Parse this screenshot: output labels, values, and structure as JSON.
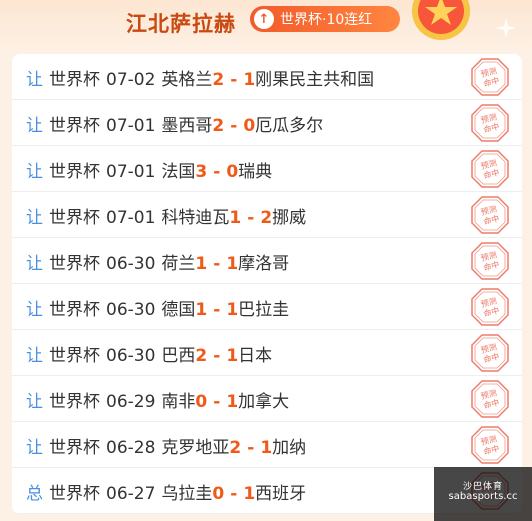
{
  "header": {
    "expert_name": "江北萨拉赫",
    "streak_label": "世界杯·10连红"
  },
  "matches": [
    {
      "kind": "让",
      "league": "世界杯",
      "date": "07-02",
      "home": "英格兰",
      "home_score": "2",
      "away_score": "1",
      "away": "刚果民主共和国",
      "stamp": "预测命中"
    },
    {
      "kind": "让",
      "league": "世界杯",
      "date": "07-01",
      "home": "墨西哥",
      "home_score": "2",
      "away_score": "0",
      "away": "厄瓜多尔",
      "stamp": "预测命中"
    },
    {
      "kind": "让",
      "league": "世界杯",
      "date": "07-01",
      "home": "法国",
      "home_score": "3",
      "away_score": "0",
      "away": "瑞典",
      "stamp": "预测命中"
    },
    {
      "kind": "让",
      "league": "世界杯",
      "date": "07-01",
      "home": "科特迪瓦",
      "home_score": "1",
      "away_score": "2",
      "away": "挪威",
      "stamp": "预测命中"
    },
    {
      "kind": "让",
      "league": "世界杯",
      "date": "06-30",
      "home": "荷兰",
      "home_score": "1",
      "away_score": "1",
      "away": "摩洛哥",
      "stamp": "预测命中"
    },
    {
      "kind": "让",
      "league": "世界杯",
      "date": "06-30",
      "home": "德国",
      "home_score": "1",
      "away_score": "1",
      "away": "巴拉圭",
      "stamp": "预测命中"
    },
    {
      "kind": "让",
      "league": "世界杯",
      "date": "06-30",
      "home": "巴西",
      "home_score": "2",
      "away_score": "1",
      "away": "日本",
      "stamp": "预测命中"
    },
    {
      "kind": "让",
      "league": "世界杯",
      "date": "06-29",
      "home": "南非",
      "home_score": "0",
      "away_score": "1",
      "away": "加拿大",
      "stamp": "预测命中"
    },
    {
      "kind": "让",
      "league": "世界杯",
      "date": "06-28",
      "home": "克罗地亚",
      "home_score": "2",
      "away_score": "1",
      "away": "加纳",
      "stamp": "预测命中"
    },
    {
      "kind": "总",
      "league": "世界杯",
      "date": "06-27",
      "home": "乌拉圭",
      "home_score": "0",
      "away_score": "1",
      "away": "西班牙",
      "stamp": "预测命中"
    }
  ],
  "watermark": {
    "top": "沙巴体育",
    "bottom": "sabasports.cc"
  },
  "colors": {
    "accent": "#f05a18",
    "kind_blue": "#4a8fe0",
    "stamp_red": "#e8503a",
    "page_bg": "#fdf1e6"
  },
  "icons": {
    "streak": "up-arrow-icon",
    "medal": "star-medal-icon",
    "sparkle": "sparkle-icon",
    "stamp": "prediction-hit-stamp-icon"
  }
}
